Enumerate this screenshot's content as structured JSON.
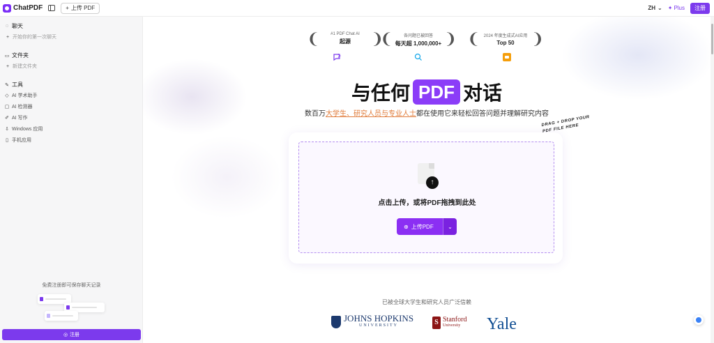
{
  "topbar": {
    "logo_text": "ChatPDF",
    "upload_label": "上传 PDF",
    "lang": "ZH",
    "plus_label": "Plus",
    "register_label": "注册"
  },
  "sidebar": {
    "chat_title": "聊天",
    "chat_new": "开始你的第一次聊天",
    "folder_title": "文件夹",
    "folder_new": "新建文件夹",
    "tools_title": "工具",
    "tools": [
      "AI 学术助手",
      "AI 检测器",
      "AI 写作",
      "Windows 应用",
      "手机应用"
    ],
    "save_hint": "免费注册即可保存聊天记录",
    "register_label": "注册"
  },
  "awards": [
    {
      "small": "#1 PDF Chat AI",
      "big": "起源",
      "icon": "chat-spark-icon",
      "color": "#7c3aed"
    },
    {
      "small": "各问题已被回答",
      "big": "每天超 1,000,000+",
      "icon": "chat-search-icon",
      "color": "#0ea5e9"
    },
    {
      "small": "2024 年度生成式AI应用",
      "big": "Top 50",
      "icon": "a16z-icon",
      "color": "#f59e0b"
    }
  ],
  "hero": {
    "title_before": "与任何",
    "title_pill": "PDF",
    "title_after": "对话",
    "subtitle_before": "数百万",
    "subtitle_highlight": "大学生、研究人员与专业人士",
    "subtitle_after": "都在使用它来轻松回答问题并理解研究内容"
  },
  "upload": {
    "drop_text": "点击上传，或将PDF拖拽到此处",
    "button_label": "上传PDF",
    "drag_hint_line1": "DRAG + DROP YOUR",
    "drag_hint_line2": "PDF FILE HERE"
  },
  "trusted": {
    "text": "已被全球大学生和研究人员广泛信赖",
    "jh_name": "JOHNS HOPKINS",
    "jh_sub": "UNIVERSITY",
    "sf_name": "Stanford",
    "sf_sub": "University",
    "yale": "Yale"
  },
  "colors": {
    "accent": "#7c3aed",
    "pill": "#8b3df8",
    "highlight": "#e07b3a"
  }
}
